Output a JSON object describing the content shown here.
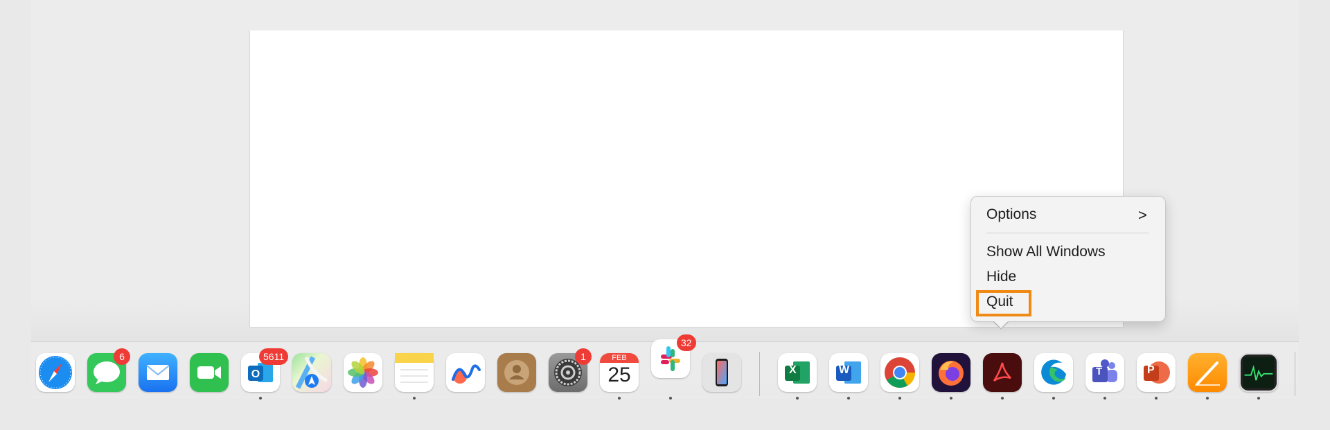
{
  "context_menu": {
    "options": "Options",
    "options_chevron": ">",
    "show_all_windows": "Show All Windows",
    "hide": "Hide",
    "quit": "Quit"
  },
  "dock": {
    "apps": [
      {
        "name": "Safari",
        "icon": "compass-icon"
      },
      {
        "name": "Messages",
        "icon": "speech-bubble-icon",
        "badge": "6"
      },
      {
        "name": "Mail",
        "icon": "envelope-icon"
      },
      {
        "name": "FaceTime",
        "icon": "video-camera-icon"
      },
      {
        "name": "Outlook",
        "icon": "outlook-icon",
        "badge": "5611"
      },
      {
        "name": "Maps",
        "icon": "map-icon"
      },
      {
        "name": "Photos",
        "icon": "flower-icon"
      },
      {
        "name": "Notes",
        "icon": "notepad-icon"
      },
      {
        "name": "Freeform",
        "icon": "freeform-icon"
      },
      {
        "name": "Contacts",
        "icon": "person-icon"
      },
      {
        "name": "System Settings",
        "icon": "gear-icon",
        "badge": "1"
      },
      {
        "name": "Calendar",
        "icon": "calendar-icon",
        "month": "FEB",
        "day": "25"
      },
      {
        "name": "Slack",
        "icon": "slack-icon",
        "badge": "32"
      },
      {
        "name": "iPhone Mirroring",
        "icon": "phone-icon"
      },
      {
        "name": "Excel",
        "icon": "excel-icon",
        "letter": "X"
      },
      {
        "name": "Word",
        "icon": "word-icon",
        "letter": "W"
      },
      {
        "name": "Chrome",
        "icon": "chrome-icon"
      },
      {
        "name": "Firefox",
        "icon": "firefox-icon"
      },
      {
        "name": "Acrobat",
        "icon": "acrobat-icon"
      },
      {
        "name": "Edge",
        "icon": "edge-icon"
      },
      {
        "name": "Teams",
        "icon": "teams-icon",
        "letter": "T"
      },
      {
        "name": "PowerPoint",
        "icon": "powerpoint-icon",
        "letter": "P"
      },
      {
        "name": "Pages",
        "icon": "pen-icon"
      },
      {
        "name": "Activity Monitor",
        "icon": "activity-monitor-icon"
      }
    ]
  },
  "colors": {
    "highlight": "#f08a17",
    "badge": "#ef3b35"
  }
}
